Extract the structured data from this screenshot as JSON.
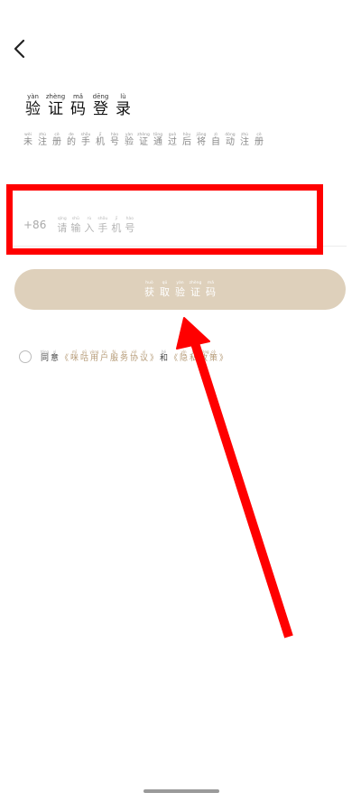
{
  "header": {
    "back_icon": "chevron-left-icon"
  },
  "title": {
    "chars": [
      {
        "py": "yàn",
        "hz": "验"
      },
      {
        "py": "zhèng",
        "hz": "证"
      },
      {
        "py": "mǎ",
        "hz": "码"
      },
      {
        "py": "dēng",
        "hz": "登"
      },
      {
        "py": "lù",
        "hz": "录"
      }
    ]
  },
  "subtitle": {
    "chars": [
      {
        "py": "wèi",
        "hz": "未"
      },
      {
        "py": "zhù",
        "hz": "注"
      },
      {
        "py": "cè",
        "hz": "册"
      },
      {
        "py": "de",
        "hz": "的"
      },
      {
        "py": "shǒu",
        "hz": "手"
      },
      {
        "py": "jī",
        "hz": "机"
      },
      {
        "py": "hào",
        "hz": "号"
      },
      {
        "py": "yàn",
        "hz": "验"
      },
      {
        "py": "zhèng",
        "hz": "证"
      },
      {
        "py": "tōng",
        "hz": "通"
      },
      {
        "py": "guò",
        "hz": "过"
      },
      {
        "py": "hòu",
        "hz": "后"
      },
      {
        "py": "jiāng",
        "hz": "将"
      },
      {
        "py": "zì",
        "hz": "自"
      },
      {
        "py": "dòng",
        "hz": "动"
      },
      {
        "py": "zhù",
        "hz": "注"
      },
      {
        "py": "cè",
        "hz": "册"
      }
    ]
  },
  "phone": {
    "country_code": "+86",
    "placeholder_chars": [
      {
        "py": "qǐng",
        "hz": "请"
      },
      {
        "py": "shū",
        "hz": "输"
      },
      {
        "py": "rù",
        "hz": "入"
      },
      {
        "py": "shǒu",
        "hz": "手"
      },
      {
        "py": "jī",
        "hz": "机"
      },
      {
        "py": "hào",
        "hz": "号"
      }
    ]
  },
  "code_button": {
    "chars": [
      {
        "py": "huò",
        "hz": "获"
      },
      {
        "py": "qǔ",
        "hz": "取"
      },
      {
        "py": "yàn",
        "hz": "验"
      },
      {
        "py": "zhèng",
        "hz": "证"
      },
      {
        "py": "mǎ",
        "hz": "码"
      }
    ],
    "color": "#ded0bb"
  },
  "agreement": {
    "prefix_chars": [
      {
        "py": "tóng",
        "hz": "同"
      },
      {
        "py": "yì",
        "hz": "意"
      }
    ],
    "service_link_chars": [
      {
        "py": "",
        "hz": "《"
      },
      {
        "py": "mī",
        "hz": "咪"
      },
      {
        "py": "gū",
        "hz": "咕"
      },
      {
        "py": "yòng",
        "hz": "用"
      },
      {
        "py": "hù",
        "hz": "户"
      },
      {
        "py": "fú",
        "hz": "服"
      },
      {
        "py": "wù",
        "hz": "务"
      },
      {
        "py": "xié",
        "hz": "协"
      },
      {
        "py": "yì",
        "hz": "议"
      },
      {
        "py": "",
        "hz": "》"
      }
    ],
    "and_chars": [
      {
        "py": "hé",
        "hz": "和"
      }
    ],
    "privacy_link_chars": [
      {
        "py": "",
        "hz": "《"
      },
      {
        "py": "yǐn",
        "hz": "隐"
      },
      {
        "py": "sī",
        "hz": "私"
      },
      {
        "py": "zhèng",
        "hz": "政"
      },
      {
        "py": "cè",
        "hz": "策"
      },
      {
        "py": "",
        "hz": "》"
      }
    ],
    "link_color": "#b59a76"
  },
  "annotation": {
    "highlight_color": "#ff0000"
  }
}
